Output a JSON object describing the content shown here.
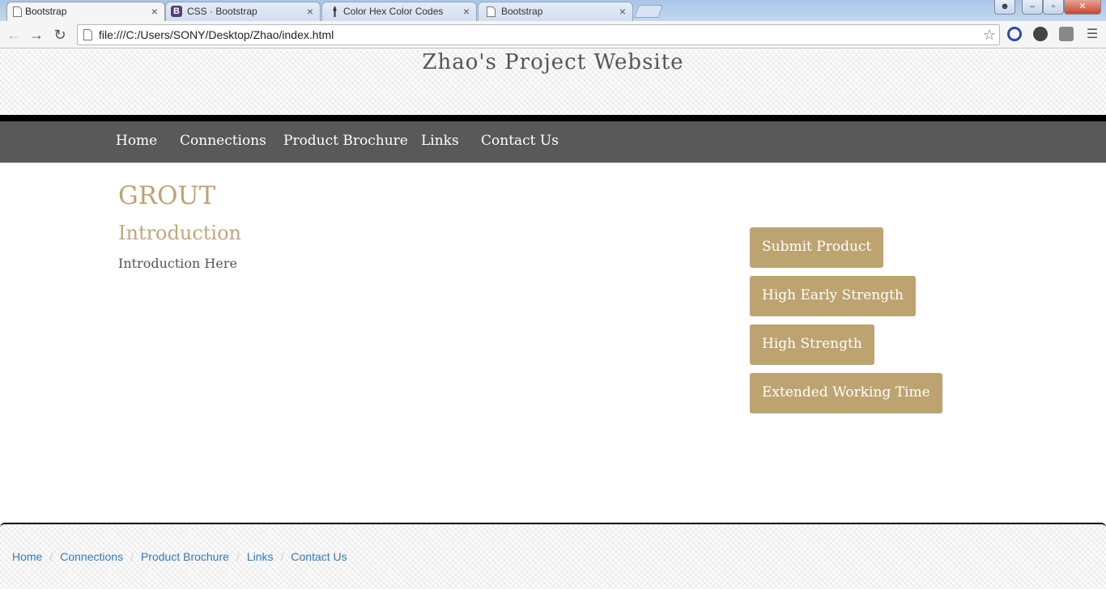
{
  "browser": {
    "tabs": [
      {
        "title": "Bootstrap",
        "icon": "page-icon"
      },
      {
        "title": "CSS · Bootstrap",
        "icon": "bootstrap-icon",
        "icon_letter": "B"
      },
      {
        "title": "Color Hex Color Codes",
        "icon": "dropper-icon"
      },
      {
        "title": "Bootstrap",
        "icon": "page-icon"
      }
    ],
    "close_glyph": "×",
    "url": "file:///C:/Users/SONY/Desktop/Zhao/index.html",
    "window_controls": {
      "minimize": "–",
      "maximize": "▫",
      "close": "✕"
    }
  },
  "site": {
    "title": "Zhao's Project Website",
    "nav": [
      "Home",
      "Connections",
      "Product Brochure",
      "Links",
      "Contact Us"
    ]
  },
  "content": {
    "heading": "GROUT",
    "subheading": "Introduction",
    "body": "Introduction Here"
  },
  "sidebar": {
    "buttons": [
      "Submit Product",
      "High Early Strength",
      "High Strength",
      "Extended Working Time"
    ]
  },
  "footer": {
    "breadcrumbs": [
      "Home",
      "Connections",
      "Product Brochure",
      "Links",
      "Contact Us"
    ],
    "separator": "/"
  },
  "colors": {
    "accent": "#bda370",
    "nav_bg": "#595959",
    "link": "#337ab7"
  }
}
